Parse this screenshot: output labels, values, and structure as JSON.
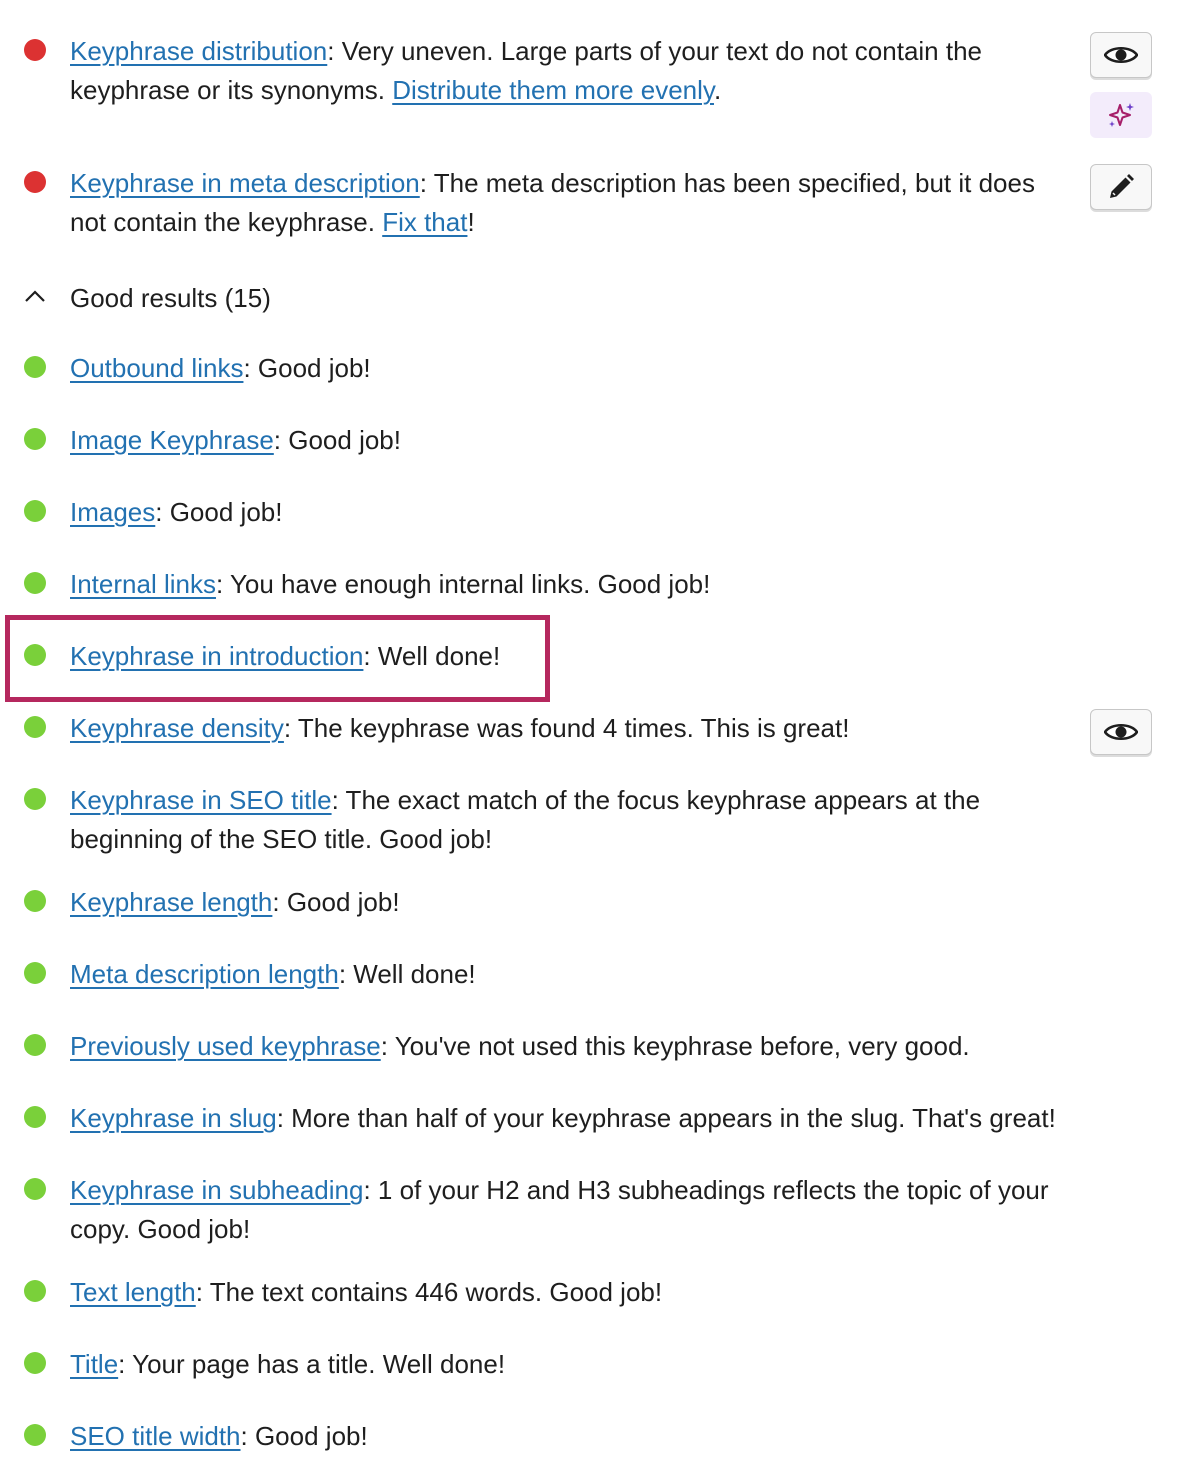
{
  "problems": [
    {
      "link": "Keyphrase distribution",
      "text": ": Very uneven. Large parts of your text do not contain the keyphrase or its synonyms. ",
      "fix_link": "Distribute them more evenly",
      "suffix": "."
    },
    {
      "link": "Keyphrase in meta description",
      "text": ": The meta description has been specified, but it does not contain the keyphrase. ",
      "fix_link": "Fix that",
      "suffix": "!"
    }
  ],
  "good_section": {
    "label": "Good results (15)"
  },
  "good": [
    {
      "link": "Outbound links",
      "text": ": Good job!"
    },
    {
      "link": "Image Keyphrase",
      "text": ": Good job!"
    },
    {
      "link": "Images",
      "text": ": Good job!"
    },
    {
      "link": "Internal links",
      "text": ": You have enough internal links. Good job!"
    },
    {
      "link": "Keyphrase in introduction",
      "text": ": Well done!"
    },
    {
      "link": "Keyphrase density",
      "text": ": The keyphrase was found 4 times. This is great!"
    },
    {
      "link": "Keyphrase in SEO title",
      "text": ": The exact match of the focus keyphrase appears at the beginning of the SEO title. Good job!"
    },
    {
      "link": "Keyphrase length",
      "text": ": Good job!"
    },
    {
      "link": "Meta description length",
      "text": ": Well done!"
    },
    {
      "link": "Previously used keyphrase",
      "text": ": You've not used this keyphrase before, very good."
    },
    {
      "link": "Keyphrase in slug",
      "text": ": More than half of your keyphrase appears in the slug. That's great!"
    },
    {
      "link": "Keyphrase in subheading",
      "text": ": 1 of your H2 and H3 subheadings reflects the topic of your copy. Good job!"
    },
    {
      "link": "Text length",
      "text": ": The text contains 446 words. Good job!"
    },
    {
      "link": "Title",
      "text": ": Your page has a title. Well done!"
    },
    {
      "link": "SEO title width",
      "text": ": Good job!"
    }
  ],
  "icons": {
    "eye": "eye-icon",
    "sparkle": "ai-sparkle-icon",
    "pencil": "pencil-icon",
    "chevron": "chevron-up-icon"
  },
  "colors": {
    "problem": "#dc3232",
    "good": "#7ad03a",
    "link": "#2271b1",
    "highlight": "#b5285e",
    "ai_accent": "#a61e69"
  }
}
